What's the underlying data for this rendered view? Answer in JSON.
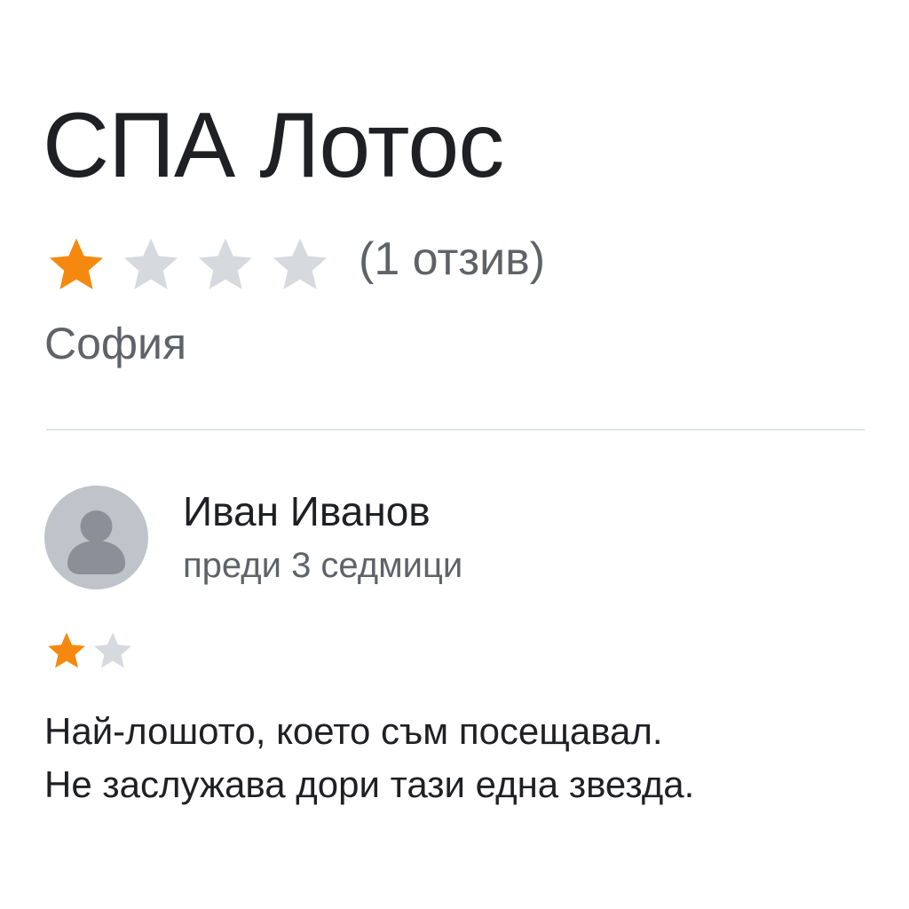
{
  "business": {
    "name": "СПА Лотос",
    "rating": 1,
    "rating_max": 4,
    "review_count_text": "(1 отзив)",
    "location": "София"
  },
  "review": {
    "author": "Иван Иванов",
    "time": "преди 3 седмици",
    "rating": 1,
    "rating_max": 2,
    "text_lines": [
      "Най-лошото, което съм посещавал.",
      "Не заслужава дори тази една звезда."
    ]
  },
  "colors": {
    "star_filled": "#f5890f",
    "star_empty": "#d6d9de",
    "avatar_bg": "#bfc4cb",
    "avatar_fg": "#8a8f98"
  },
  "icons": {
    "star": "star-icon",
    "avatar": "person-avatar-icon"
  }
}
